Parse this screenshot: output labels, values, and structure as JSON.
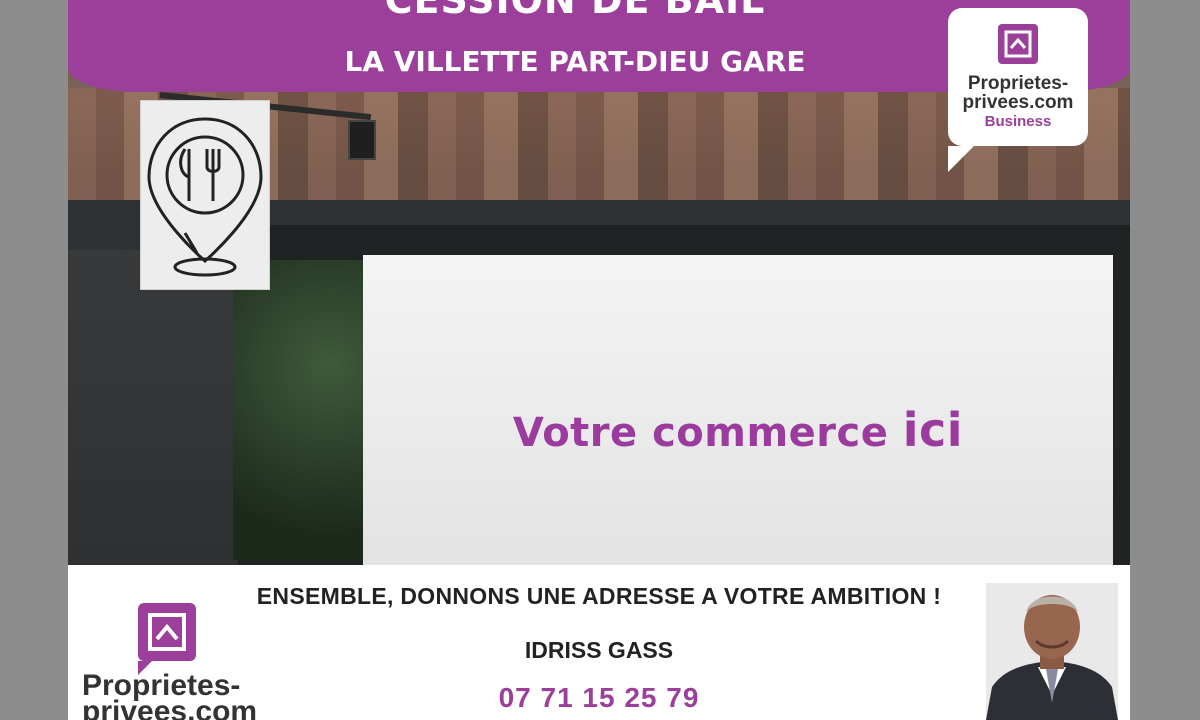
{
  "banner": {
    "title": "CESSION DE BAIL",
    "subtitle": "LA VILLETTE PART-DIEU GARE"
  },
  "brand_logo": {
    "line1": "Proprietes-",
    "line2": "privees.com",
    "line3": "Business",
    "icon": "house-frame-icon"
  },
  "sign": {
    "icon": "restaurant-pin-icon"
  },
  "storefront": {
    "text_main": "Votre commerce",
    "text_emph": "ici"
  },
  "footer": {
    "slogan": "ENSEMBLE, DONNONS UNE ADRESSE A VOTRE AMBITION !",
    "agent_name": "IDRISS GASS",
    "phone": "07 71 15 25 79",
    "logo_line1": "Proprietes-",
    "logo_line2": "privees.com",
    "logo_icon": "house-frame-icon",
    "photo": "agent-portrait"
  },
  "colors": {
    "brand_purple": "#9b3f9b",
    "text_dark": "#222222",
    "white": "#ffffff"
  }
}
